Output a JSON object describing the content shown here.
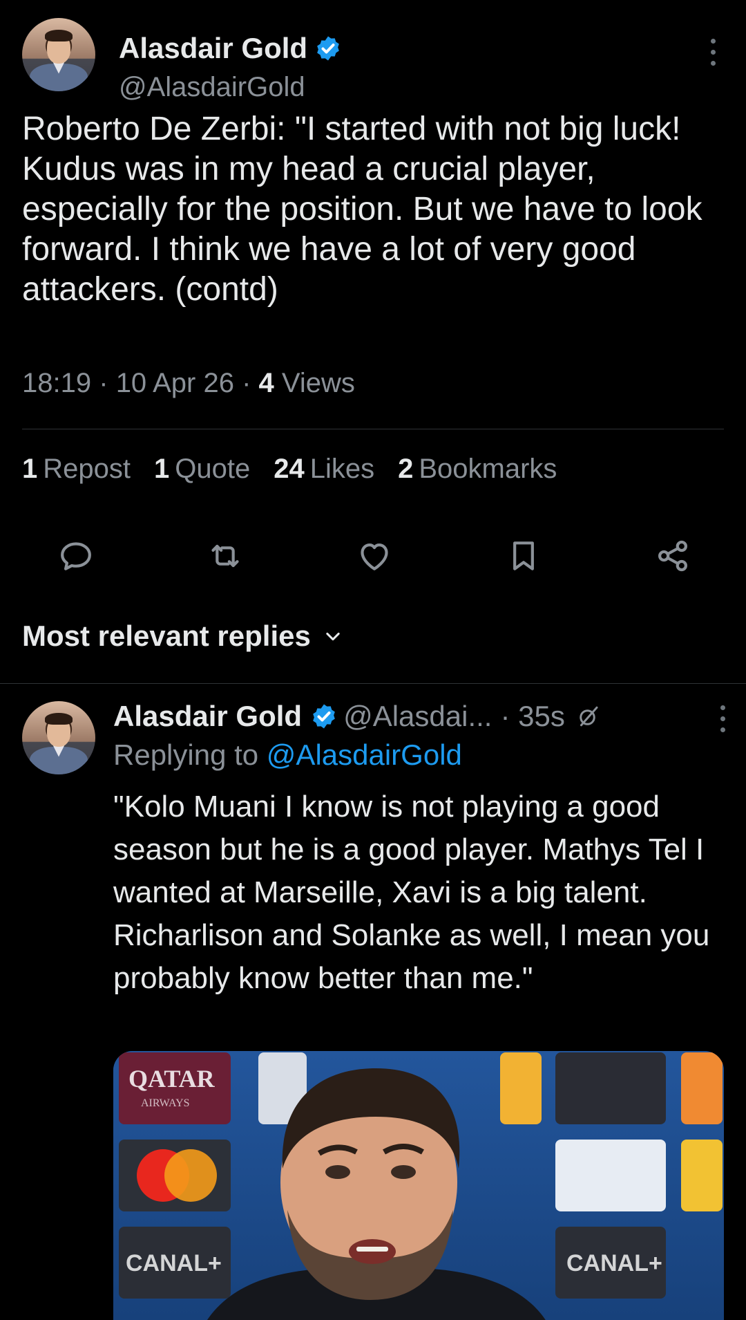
{
  "main_tweet": {
    "author_name": "Alasdair Gold",
    "handle": "@AlasdairGold",
    "text": "Roberto De Zerbi: \"I started with not big luck! Kudus was in my head a crucial player, especially for the position. But we have to look forward. I think we have a lot of very good attackers. (contd)",
    "time": "18:19",
    "date": "10 Apr 26",
    "separator": "·",
    "views_count": "4",
    "views_label": "Views",
    "stats": [
      {
        "count": "1",
        "label": "Repost"
      },
      {
        "count": "1",
        "label": "Quote"
      },
      {
        "count": "24",
        "label": "Likes"
      },
      {
        "count": "2",
        "label": "Bookmarks"
      }
    ],
    "actions": [
      "reply-icon",
      "repost-icon",
      "like-icon",
      "bookmark-icon",
      "share-icon"
    ]
  },
  "replies_sort": {
    "label": "Most relevant replies"
  },
  "reply": {
    "author_name": "Alasdair Gold",
    "handle": "@Alasdai...",
    "time": "· 35s",
    "replying_prefix": "Replying to",
    "replying_to": "@AlasdairGold",
    "text": "\"Kolo Muani I know is not playing a good season but he is a good player. Mathys Tel I wanted at Marseille, Xavi is a big talent. Richarlison and Solanke as well, I mean you probably know better than me.\"",
    "media": {
      "sponsor_logos": [
        "QATAR",
        "AIRWAYS",
        "CANAL+",
        "CANAL+"
      ]
    }
  },
  "colors": {
    "background": "#000000",
    "text": "#e7e9ea",
    "muted": "#8b9198",
    "accent": "#1d9bf0",
    "divider": "#2f3336"
  }
}
